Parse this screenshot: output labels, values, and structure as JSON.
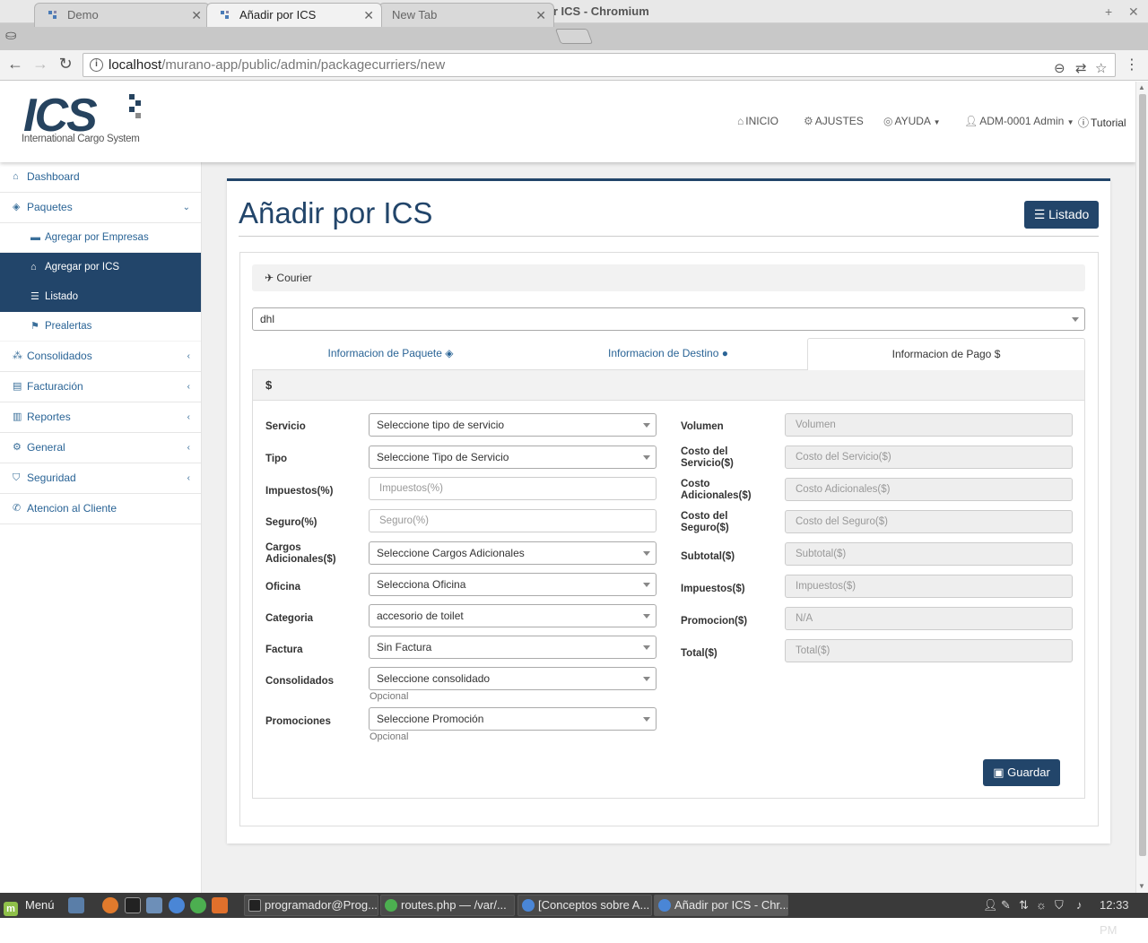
{
  "browser": {
    "window_title": "Añadir por ICS - Chromium",
    "tabs": [
      {
        "title": "Demo"
      },
      {
        "title": "Añadir por ICS"
      },
      {
        "title": "New Tab"
      }
    ],
    "url_host": "localhost",
    "url_path": "/murano-app/public/admin/packagecurriers/new"
  },
  "app": {
    "logo_text": "ICS",
    "logo_subtitle": "International Cargo System",
    "nav": {
      "inicio": "INICIO",
      "ajustes": "AJUSTES",
      "ayuda": "AYUDA",
      "user": "ADM-0001 Admin",
      "tutorial": "Tutorial"
    }
  },
  "sidebar": {
    "items": [
      {
        "label": "Dashboard",
        "icon": "dashboard-icon"
      },
      {
        "label": "Paquetes",
        "icon": "cube-icon"
      },
      {
        "label": "Agregar por Empresas",
        "icon": "briefcase-icon"
      },
      {
        "label": "Agregar por ICS",
        "icon": "home-icon"
      },
      {
        "label": "Listado",
        "icon": "list-icon"
      },
      {
        "label": "Prealertas",
        "icon": "flag-icon"
      },
      {
        "label": "Consolidados",
        "icon": "cubes-icon"
      },
      {
        "label": "Facturación",
        "icon": "file-icon"
      },
      {
        "label": "Reportes",
        "icon": "bar-chart-icon"
      },
      {
        "label": "General",
        "icon": "gears-icon"
      },
      {
        "label": "Seguridad",
        "icon": "shield-icon"
      },
      {
        "label": "Atencion al Cliente",
        "icon": "phone-icon"
      }
    ]
  },
  "main": {
    "title": "Añadir por ICS",
    "listado_button": "Listado",
    "courier_label": "Courier",
    "courier_value": "dhl",
    "tabs": [
      {
        "label": "Informacion de Paquete"
      },
      {
        "label": "Informacion de Destino"
      },
      {
        "label": "Informacion de Pago"
      }
    ],
    "payment_header": "$",
    "left_fields": [
      {
        "label": "Servicio",
        "value": "Seleccione tipo de servicio",
        "kind": "select"
      },
      {
        "label": "Tipo",
        "value": "Seleccione Tipo de Servicio",
        "kind": "select"
      },
      {
        "label": "Impuestos(%)",
        "placeholder": "Impuestos(%)",
        "kind": "input"
      },
      {
        "label": "Seguro(%)",
        "placeholder": "Seguro(%)",
        "kind": "input"
      },
      {
        "label": "Cargos Adicionales($)",
        "value": "Seleccione Cargos Adicionales",
        "kind": "select"
      },
      {
        "label": "Oficina",
        "value": "Selecciona Oficina",
        "kind": "select"
      },
      {
        "label": "Categoria",
        "value": "accesorio de toilet",
        "kind": "select"
      },
      {
        "label": "Factura",
        "value": "Sin Factura",
        "kind": "select"
      },
      {
        "label": "Consolidados",
        "value": "Seleccione consolidado",
        "kind": "select",
        "help": "Opcional"
      },
      {
        "label": "Promociones",
        "value": "Seleccione Promoción",
        "kind": "select",
        "help": "Opcional"
      }
    ],
    "right_fields": [
      {
        "label": "Volumen",
        "placeholder": "Volumen"
      },
      {
        "label": "Costo del Servicio($)",
        "placeholder": "Costo del Servicio($)"
      },
      {
        "label": "Costo Adicionales($)",
        "placeholder": "Costo Adicionales($)"
      },
      {
        "label": "Costo del Seguro($)",
        "placeholder": "Costo del Seguro($)"
      },
      {
        "label": "Subtotal($)",
        "placeholder": "Subtotal($)"
      },
      {
        "label": "Impuestos($)",
        "placeholder": "Impuestos($)"
      },
      {
        "label": "Promocion($)",
        "placeholder": "N/A"
      },
      {
        "label": "Total($)",
        "placeholder": "Total($)"
      }
    ],
    "save_button": "Guardar"
  },
  "taskbar": {
    "menu_label": "Menú",
    "tasks": [
      {
        "label": "programador@Prog..."
      },
      {
        "label": "routes.php — /var/..."
      },
      {
        "label": "[Conceptos sobre A..."
      },
      {
        "label": "Añadir por ICS - Chr..."
      }
    ],
    "clock": "12:33 PM"
  },
  "colors": {
    "brand": "#22456a",
    "link": "#2a6496"
  }
}
